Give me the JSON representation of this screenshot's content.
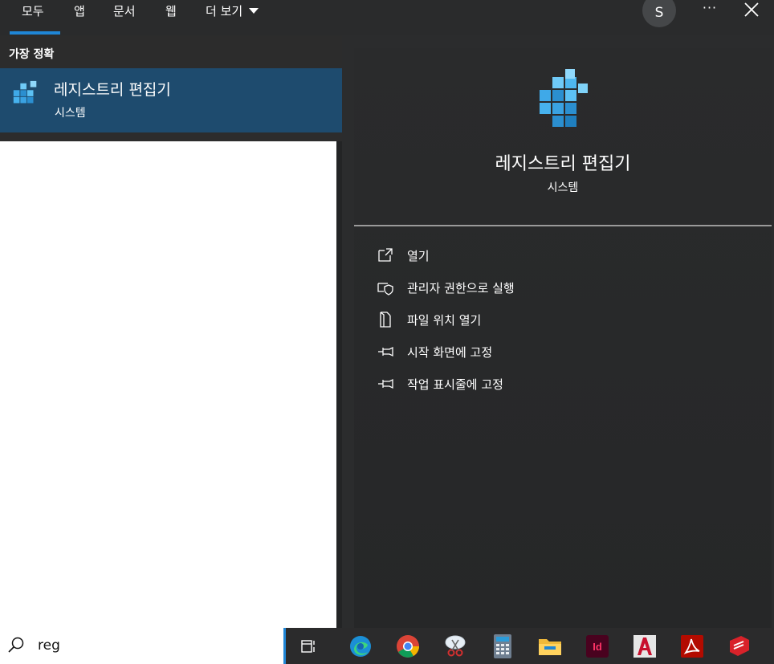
{
  "tabs": [
    {
      "label": "모두"
    },
    {
      "label": "앱"
    },
    {
      "label": "문서"
    },
    {
      "label": "웹"
    },
    {
      "label": "더 보기"
    }
  ],
  "account": {
    "initial": "S"
  },
  "more_label": "···",
  "best_match": {
    "section_title": "가장 정확",
    "title": "레지스트리 편집기",
    "subtitle": "시스템"
  },
  "detail": {
    "title": "레지스트리 편집기",
    "subtitle": "시스템",
    "actions": [
      {
        "label": "열기",
        "icon": "open-icon"
      },
      {
        "label": "관리자 권한으로 실행",
        "icon": "shield-icon"
      },
      {
        "label": "파일 위치 열기",
        "icon": "file-location-icon"
      },
      {
        "label": "시작 화면에 고정",
        "icon": "pin-icon"
      },
      {
        "label": "작업 표시줄에 고정",
        "icon": "pin-icon"
      }
    ]
  },
  "search": {
    "query": "reg"
  },
  "taskbar_apps": [
    "task-view-icon",
    "edge-icon",
    "chrome-icon",
    "snipping-tool-icon",
    "calculator-icon",
    "file-explorer-icon",
    "indesign-icon",
    "autocad-icon",
    "acrobat-icon",
    "sketchup-icon"
  ],
  "colors": {
    "accent": "#1f86d6",
    "selection": "#1e4b6e",
    "dark": "#2b2c2d"
  }
}
